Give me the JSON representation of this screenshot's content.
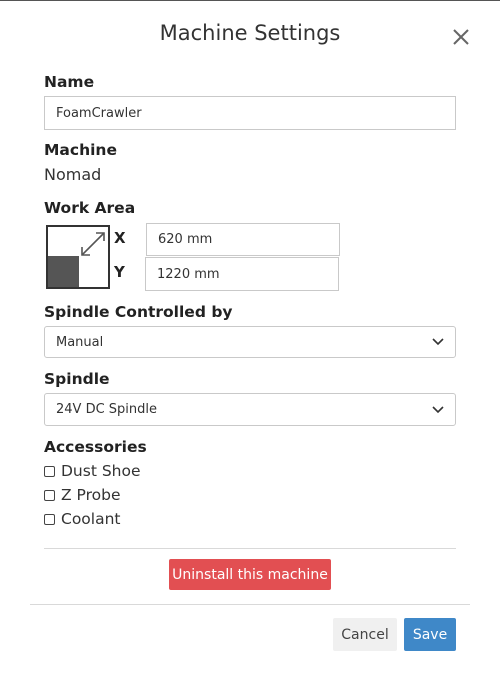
{
  "dialog": {
    "title": "Machine Settings"
  },
  "name": {
    "label": "Name",
    "value": "FoamCrawler"
  },
  "machine": {
    "label": "Machine",
    "value": "Nomad"
  },
  "work_area": {
    "label": "Work Area",
    "x_label": "X",
    "x_value": "620 mm",
    "y_label": "Y",
    "y_value": "1220 mm"
  },
  "spindle_controlled_by": {
    "label": "Spindle Controlled by",
    "selected": "Manual"
  },
  "spindle": {
    "label": "Spindle",
    "selected": "24V DC Spindle"
  },
  "accessories": {
    "label": "Accessories",
    "items": [
      {
        "label": "Dust Shoe",
        "checked": false
      },
      {
        "label": "Z Probe",
        "checked": false
      },
      {
        "label": "Coolant",
        "checked": false
      }
    ]
  },
  "actions": {
    "uninstall_label": "Uninstall this machine",
    "cancel_label": "Cancel",
    "save_label": "Save"
  },
  "colors": {
    "danger": "#e24f52",
    "primary": "#3f88c8"
  }
}
